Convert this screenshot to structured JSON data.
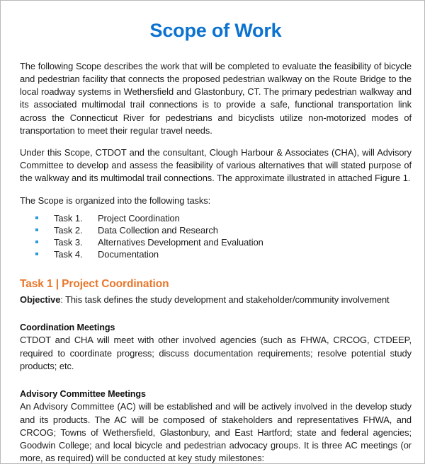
{
  "document": {
    "title": "Scope of Work",
    "title_color": "#0b72d0",
    "accent_color": "#e8762b",
    "bullet_color": "#2e9bd6"
  },
  "intro": {
    "paragraph_1": "The following Scope describes the work that will be completed to evaluate the feasibility of bicycle and pedestrian facility that connects the proposed pedestrian walkway on the Route Bridge to the local roadway systems in Wethersfield and Glastonbury, CT.  The primary pedestrian walkway and its associated multimodal trail connections is to provide a safe, functional transportation link across the Connecticut River for pedestrians and bicyclists utilize non-motorized modes of transportation to meet their regular travel needs.",
    "paragraph_2": "Under this Scope, CTDOT and the consultant, Clough Harbour & Associates (CHA), will Advisory Committee to develop and assess the feasibility of various alternatives that will stated purpose of the walkway and its multimodal trail connections.  The approximate illustrated in attached Figure 1.",
    "list_lead_in": "The Scope is organized into the following tasks:"
  },
  "tasks": [
    {
      "number": "Task 1.",
      "label": "Project Coordination"
    },
    {
      "number": "Task 2.",
      "label": "Data Collection and Research"
    },
    {
      "number": "Task 3.",
      "label": "Alternatives Development and Evaluation"
    },
    {
      "number": "Task 4.",
      "label": "Documentation"
    }
  ],
  "task_section": {
    "heading_strong": "Task 1",
    "heading_rest": " | Project Coordination",
    "objective_label": "Objective",
    "objective_text": ":  This task defines the study development and stakeholder/community involvement",
    "subsections": [
      {
        "heading": "Coordination Meetings",
        "body": "CTDOT and CHA will meet with other involved agencies (such as FHWA, CRCOG, CTDEEP, required to coordinate progress;  discuss documentation requirements; resolve potential study products; etc."
      },
      {
        "heading": "Advisory Committee Meetings",
        "body": "An Advisory Committee (AC) will be established and will be actively involved in the develop study and its products.  The AC will be composed of stakeholders and representatives FHWA, and CRCOG; Towns of Wethersfield, Glastonbury, and East Hartford; state and federal agencies; Goodwin College; and local bicycle and pedestrian advocacy groups.  It is three AC meetings (or more, as required) will be conducted at key study milestones:"
      }
    ]
  }
}
